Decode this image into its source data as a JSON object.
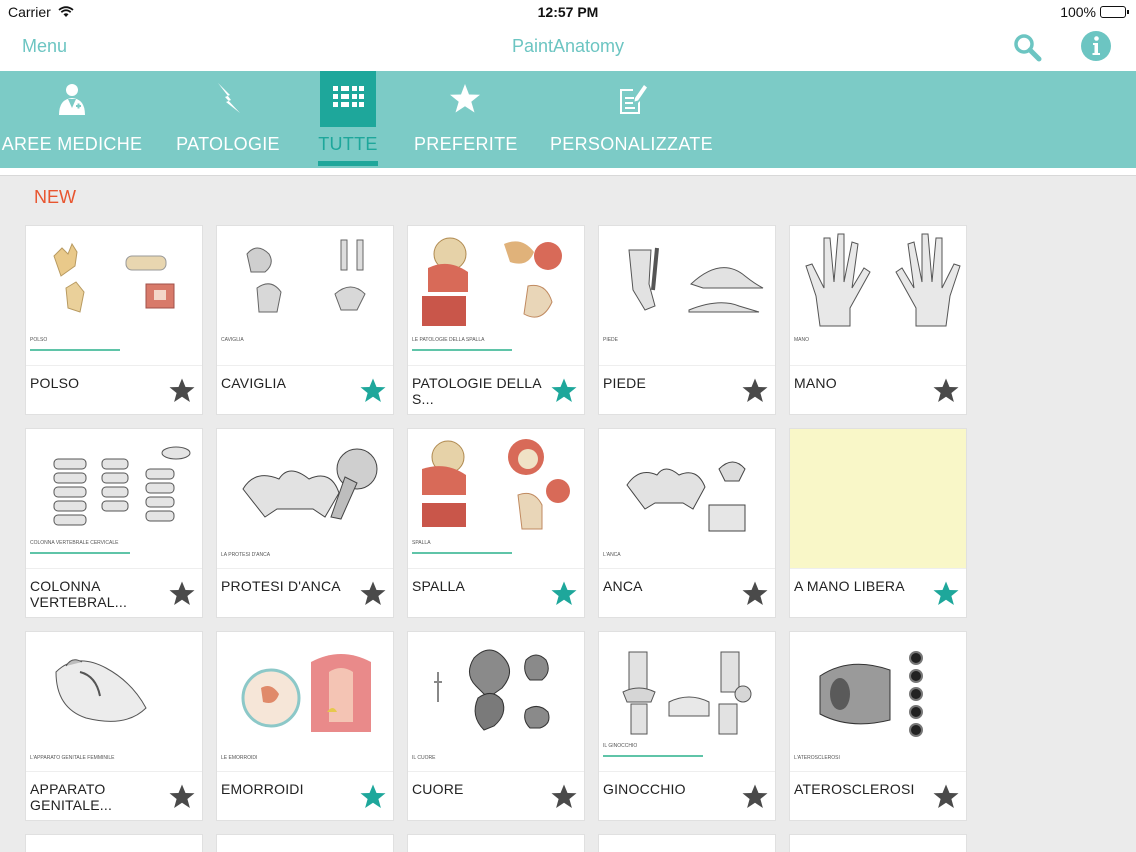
{
  "status_bar": {
    "carrier": "Carrier",
    "time": "12:57 PM",
    "battery": "100%"
  },
  "nav": {
    "menu_label": "Menu",
    "title": "PaintAnatomy",
    "accent_color": "#6cc5c2"
  },
  "tabs": [
    {
      "label": "AREE MEDICHE",
      "icon": "doctor-icon",
      "active": false
    },
    {
      "label": "PATOLOGIE",
      "icon": "lightning-icon",
      "active": false
    },
    {
      "label": "TUTTE",
      "icon": "grid-list-icon",
      "active": true
    },
    {
      "label": "PREFERITE",
      "icon": "star-icon",
      "active": false
    },
    {
      "label": "PERSONALIZZATE",
      "icon": "edit-document-icon",
      "active": false
    }
  ],
  "section_title": "NEW",
  "cards": [
    {
      "name": "POLSO",
      "favorite": false,
      "caption": "POLSO"
    },
    {
      "name": "CAVIGLIA",
      "favorite": true,
      "caption": "CAVIGLIA"
    },
    {
      "name": "PATOLOGIE DELLA S...",
      "favorite": true,
      "caption": "LE PATOLOGIE DELLA SPALLA"
    },
    {
      "name": "PIEDE",
      "favorite": false,
      "caption": "PIEDE"
    },
    {
      "name": "MANO",
      "favorite": false,
      "caption": "MANO"
    },
    {
      "name": "COLONNA VERTEBRAL...",
      "favorite": false,
      "caption": "COLONNA VERTEBRALE CERVICALE"
    },
    {
      "name": "PROTESI D'ANCA",
      "favorite": false,
      "caption": "LA PROTESI D'ANCA"
    },
    {
      "name": "SPALLA",
      "favorite": true,
      "caption": "SPALLA"
    },
    {
      "name": "ANCA",
      "favorite": false,
      "caption": "L'ANCA"
    },
    {
      "name": "A MANO LIBERA",
      "favorite": true,
      "caption": ""
    },
    {
      "name": "APPARATO GENITALE...",
      "favorite": false,
      "caption": "L'APPARATO GENITALE FEMMINILE"
    },
    {
      "name": "EMORROIDI",
      "favorite": true,
      "caption": "LE EMORROIDI"
    },
    {
      "name": "CUORE",
      "favorite": false,
      "caption": "IL CUORE"
    },
    {
      "name": "GINOCCHIO",
      "favorite": false,
      "caption": "IL GINOCCHIO"
    },
    {
      "name": "ATEROSCLEROSI",
      "favorite": false,
      "caption": "L'ATEROSCLEROSI"
    }
  ],
  "colors": {
    "tabbar": "#7ccbc6",
    "active": "#1ea79b",
    "star_on": "#1ea79b",
    "star_off": "#4a4a4a",
    "new_label": "#e8552f"
  }
}
